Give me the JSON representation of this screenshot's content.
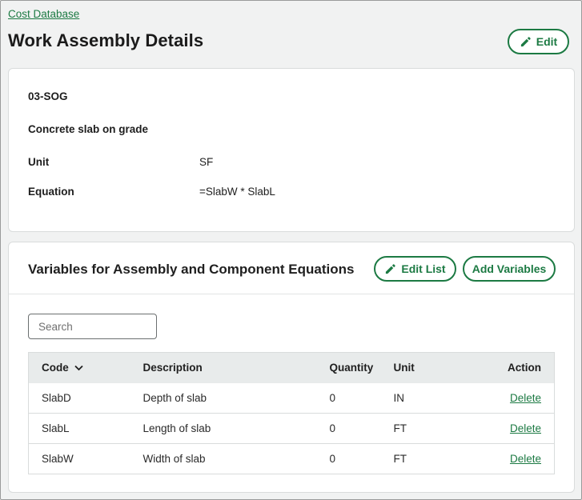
{
  "breadcrumb": {
    "label": "Cost Database"
  },
  "header": {
    "title": "Work Assembly Details",
    "edit_label": "Edit"
  },
  "details": {
    "code": "03-SOG",
    "description": "Concrete slab on grade",
    "unit_label": "Unit",
    "unit_value": "SF",
    "equation_label": "Equation",
    "equation_value": "=SlabW * SlabL"
  },
  "variables": {
    "title": "Variables for Assembly and Component Equations",
    "edit_list_label": "Edit List",
    "add_variables_label": "Add Variables",
    "search_placeholder": "Search",
    "columns": {
      "code": "Code",
      "description": "Description",
      "quantity": "Quantity",
      "unit": "Unit",
      "action": "Action"
    },
    "rows": [
      {
        "code": "SlabD",
        "description": "Depth of slab",
        "quantity": "0",
        "unit": "IN",
        "action": "Delete"
      },
      {
        "code": "SlabL",
        "description": "Length of slab",
        "quantity": "0",
        "unit": "FT",
        "action": "Delete"
      },
      {
        "code": "SlabW",
        "description": "Width of slab",
        "quantity": "0",
        "unit": "FT",
        "action": "Delete"
      }
    ]
  },
  "colors": {
    "accent": "#1c7a43",
    "background": "#f1f2f2",
    "header_row": "#e8ebeb"
  },
  "icons": {
    "edit": "pencil-icon",
    "sort": "chevron-down-icon"
  }
}
